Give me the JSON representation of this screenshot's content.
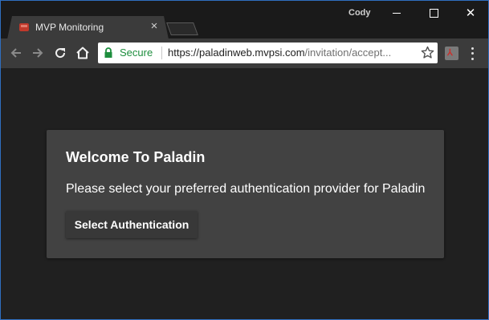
{
  "browser": {
    "tab_title": "MVP Monitoring",
    "tab_close_symbol": "×",
    "profile_name": "Cody",
    "favicon_icon": "app-favicon-icon",
    "window_controls": {
      "minimize_icon": "minimize-icon",
      "maximize_icon": "maximize-icon",
      "close_symbol": "✕"
    }
  },
  "toolbar": {
    "secure_label": "Secure",
    "url_host": "https://paladinweb.mvpsi.com",
    "url_rest": "/invitation/accept...",
    "icons": [
      "back-arrow-icon",
      "forward-arrow-icon",
      "reload-icon",
      "home-icon",
      "lock-icon",
      "bookmark-star-icon",
      "pdf-extension-icon",
      "menu-dots-icon"
    ]
  },
  "page": {
    "title": "Welcome To Paladin",
    "message": "Please select your preferred authentication provider for Paladin",
    "button_label": "Select Authentication"
  },
  "colors": {
    "page_background": "#202020",
    "card_background": "#424242",
    "secure_green": "#1e8e3e",
    "window_border": "#2f6fc0"
  }
}
